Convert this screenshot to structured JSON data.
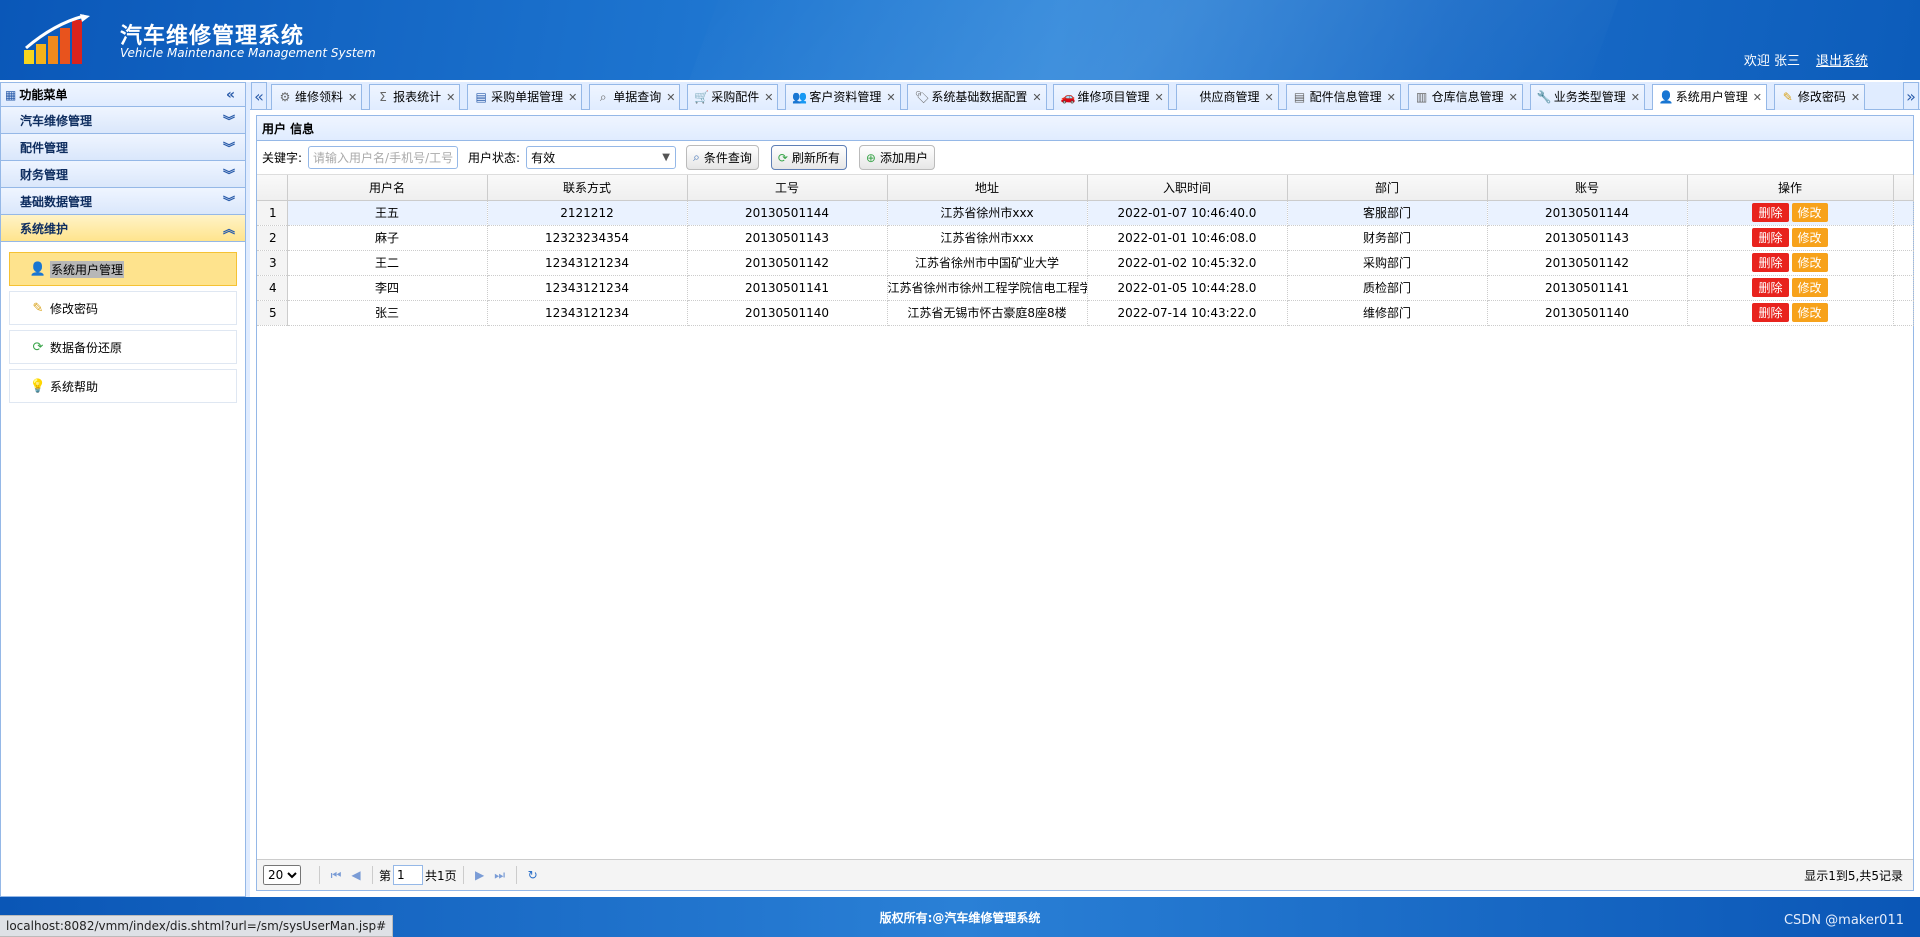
{
  "header": {
    "title": "汽车维修管理系统",
    "subtitle": "Vehicle Maintenance Management System",
    "welcome": "欢迎 张三",
    "logout": "退出系统"
  },
  "menu": {
    "title": "功能菜单",
    "sections": [
      {
        "label": "汽车维修管理"
      },
      {
        "label": "配件管理"
      },
      {
        "label": "财务管理"
      },
      {
        "label": "基础数据管理"
      },
      {
        "label": "系统维护"
      }
    ],
    "items": [
      {
        "label": "系统用户管理",
        "icon": "user-icon"
      },
      {
        "label": "修改密码",
        "icon": "pencil-icon"
      },
      {
        "label": "数据备份还原",
        "icon": "refresh-icon"
      },
      {
        "label": "系统帮助",
        "icon": "lightbulb-icon"
      }
    ]
  },
  "tabs": [
    {
      "label": "维修领料",
      "icon": "tools-icon"
    },
    {
      "label": "报表统计",
      "icon": "sigma-icon"
    },
    {
      "label": "采购单据管理",
      "icon": "document-icon"
    },
    {
      "label": "单据查询",
      "icon": "search-icon"
    },
    {
      "label": "采购配件",
      "icon": "cart-icon"
    },
    {
      "label": "客户资料管理",
      "icon": "users-icon"
    },
    {
      "label": "系统基础数据配置",
      "icon": "tag-icon"
    },
    {
      "label": "维修项目管理",
      "icon": "car-icon"
    },
    {
      "label": "供应商管理",
      "icon": ""
    },
    {
      "label": "配件信息管理",
      "icon": "document-icon"
    },
    {
      "label": "仓库信息管理",
      "icon": "warehouse-icon"
    },
    {
      "label": "业务类型管理",
      "icon": "wrench-icon"
    },
    {
      "label": "系统用户管理",
      "icon": "user-icon"
    },
    {
      "label": "修改密码",
      "icon": "pencil-icon"
    }
  ],
  "panel": {
    "title": "用户 信息",
    "keyword_label": "关键字:",
    "keyword_placeholder": "请输入用户名/手机号/工号",
    "status_label": "用户状态:",
    "status_value": "有效",
    "btn_query": "条件查询",
    "btn_refresh": "刷新所有",
    "btn_add": "添加用户"
  },
  "table": {
    "columns": [
      "用户名",
      "联系方式",
      "工号",
      "地址",
      "入职时间",
      "部门",
      "账号",
      "操作"
    ],
    "rows": [
      {
        "n": "1",
        "name": "王五",
        "phone": "2121212",
        "id": "20130501144",
        "addr": "江苏省徐州市xxx",
        "date": "2022-01-07 10:46:40.0",
        "dept": "客服部门",
        "acct": "20130501144"
      },
      {
        "n": "2",
        "name": "麻子",
        "phone": "12323234354",
        "id": "20130501143",
        "addr": "江苏省徐州市xxx",
        "date": "2022-01-01 10:46:08.0",
        "dept": "财务部门",
        "acct": "20130501143"
      },
      {
        "n": "3",
        "name": "王二",
        "phone": "12343121234",
        "id": "20130501142",
        "addr": "江苏省徐州市中国矿业大学",
        "date": "2022-01-02 10:45:32.0",
        "dept": "采购部门",
        "acct": "20130501142"
      },
      {
        "n": "4",
        "name": "李四",
        "phone": "12343121234",
        "id": "20130501141",
        "addr": "江苏省徐州市徐州工程学院信电工程学",
        "date": "2022-01-05 10:44:28.0",
        "dept": "质检部门",
        "acct": "20130501141"
      },
      {
        "n": "5",
        "name": "张三",
        "phone": "12343121234",
        "id": "20130501140",
        "addr": "江苏省无锡市怀古豪庭8座8楼",
        "date": "2022-07-14 10:43:22.0",
        "dept": "维修部门",
        "acct": "20130501140"
      }
    ],
    "action_delete": "删除",
    "action_edit": "修改"
  },
  "pager": {
    "page_size": "20",
    "page_prefix": "第",
    "page_value": "1",
    "page_total": "共1页",
    "info": "显示1到5,共5记录"
  },
  "footer": {
    "copyright": "版权所有:@汽车维修管理系统",
    "status_url": "localhost:8082/vmm/index/dis.shtml?url=/sm/sysUserMan.jsp#",
    "watermark": "CSDN @maker011"
  },
  "colors": {
    "header_blue": "#1d74cf",
    "active_yellow": "#fee38d",
    "delete_red": "#e8231d",
    "edit_orange": "#f7a21b"
  }
}
